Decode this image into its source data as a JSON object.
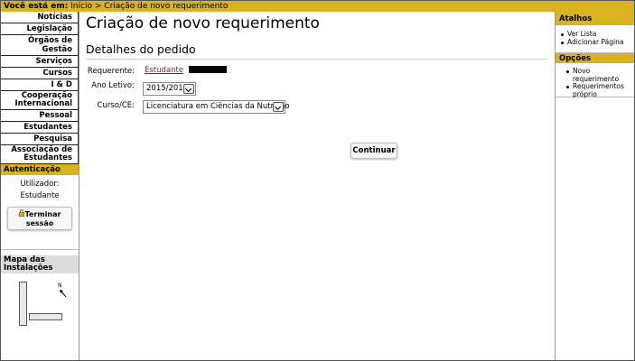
{
  "breadcrumb": {
    "label": "Você está em:",
    "home": "Início",
    "separator": ">",
    "current": "Criação de novo requerimento"
  },
  "nav": {
    "items": [
      "Notícias",
      "Legislação",
      "Órgãos de Gestão",
      "Serviços",
      "Cursos",
      "I & D",
      "Cooperação Internacional",
      "Pessoal",
      "Estudantes",
      "Pesquisa",
      "Associação de Estudantes"
    ]
  },
  "auth": {
    "title": "Autenticação",
    "user_label": "Utilizador:",
    "user_value": "Estudante",
    "logout_label": "Terminar sessão"
  },
  "map": {
    "title": "Mapa das Instalações",
    "north": "N"
  },
  "main": {
    "title": "Criação de novo requerimento",
    "section": "Detalhes do pedido"
  },
  "form": {
    "requester_label": "Requerente:",
    "requester_value": "Estudante",
    "year_label": "Ano Letivo:",
    "year_value": "2015/2016",
    "course_label": "Curso/CE:",
    "course_value": "Licenciatura em Ciências da Nutrição",
    "continue_label": "Continuar"
  },
  "right": {
    "shortcuts_title": "Atalhos",
    "shortcuts": [
      "Ver Lista",
      "Adicionar Página"
    ],
    "options_title": "Opções",
    "options": [
      "Novo requerimento",
      "Requerimentos próprio"
    ]
  },
  "colors": {
    "accent": "#d9b21f",
    "link": "#8b1a1a"
  }
}
